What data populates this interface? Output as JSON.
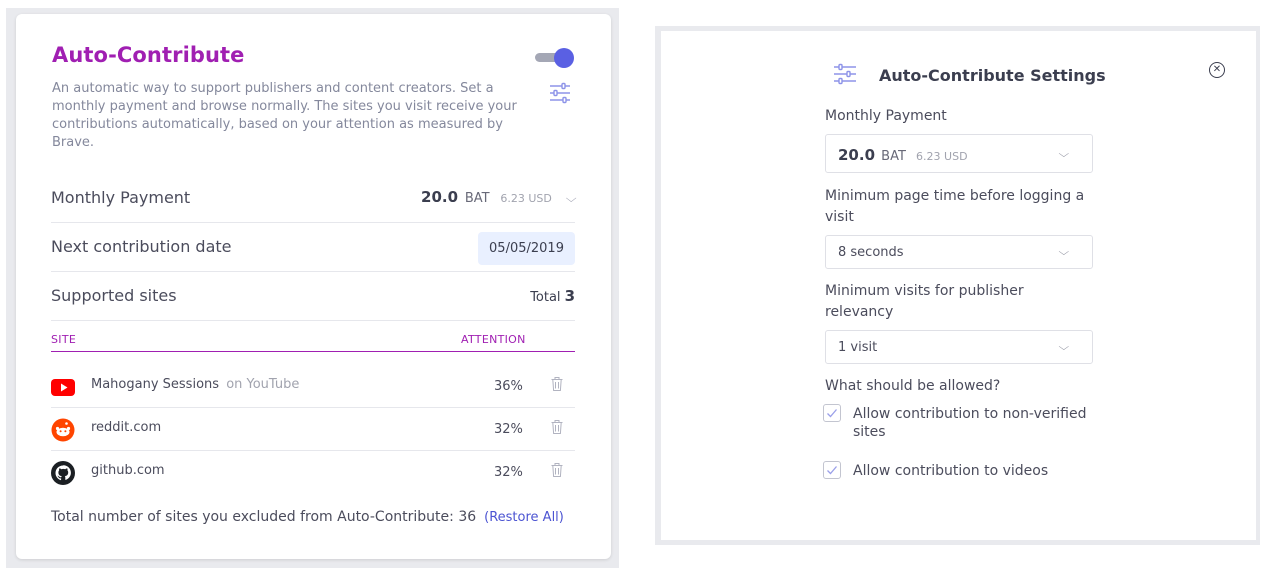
{
  "auto_contribute": {
    "title": "Auto-Contribute",
    "description": "An automatic way to support publishers and content creators. Set a monthly payment and browse normally. The sites you visit receive your contributions automatically, based on your attention as measured by Brave.",
    "toggle_on": true,
    "monthly_payment": {
      "label": "Monthly Payment",
      "amount": "20.0",
      "currency": "BAT",
      "usd": "6.23 USD",
      "chevron": "⌵"
    },
    "next_contribution": {
      "label": "Next contribution date",
      "date": "05/05/2019"
    },
    "supported_sites": {
      "label": "Supported sites",
      "total_label": "Total",
      "total_value": "3"
    },
    "table": {
      "col_site": "SITE",
      "col_attention": "ATTENTION",
      "rows": [
        {
          "icon": "youtube-icon",
          "name": "Mahogany Sessions",
          "provider": "on YouTube",
          "attention": "36%"
        },
        {
          "icon": "reddit-icon",
          "name": "reddit.com",
          "provider": "",
          "attention": "32%"
        },
        {
          "icon": "github-icon",
          "name": "github.com",
          "provider": "",
          "attention": "32%"
        }
      ]
    },
    "excluded_text": "Total number of sites you excluded from Auto-Contribute: 36",
    "restore_all": "(Restore All)"
  },
  "settings_modal": {
    "title": "Auto-Contribute Settings",
    "close": "✕",
    "monthly_payment_label": "Monthly Payment",
    "monthly_payment": {
      "amount": "20.0",
      "currency": "BAT",
      "usd": "6.23 USD"
    },
    "min_time_label": "Minimum page time before logging a visit",
    "min_time_value": "8 seconds",
    "min_visits_label": "Minimum visits for publisher relevancy",
    "min_visits_value": "1 visit",
    "allowed_label": "What should be allowed?",
    "allow_nonverified": "Allow contribution to non-verified sites",
    "allow_videos": "Allow contribution to videos",
    "chevron": "⌵"
  },
  "colors": {
    "accent_purple": "#a01fb2",
    "toggle_blue": "#5a60e3",
    "link_blue": "#4c54d2",
    "date_bg": "#e9f0ff"
  }
}
